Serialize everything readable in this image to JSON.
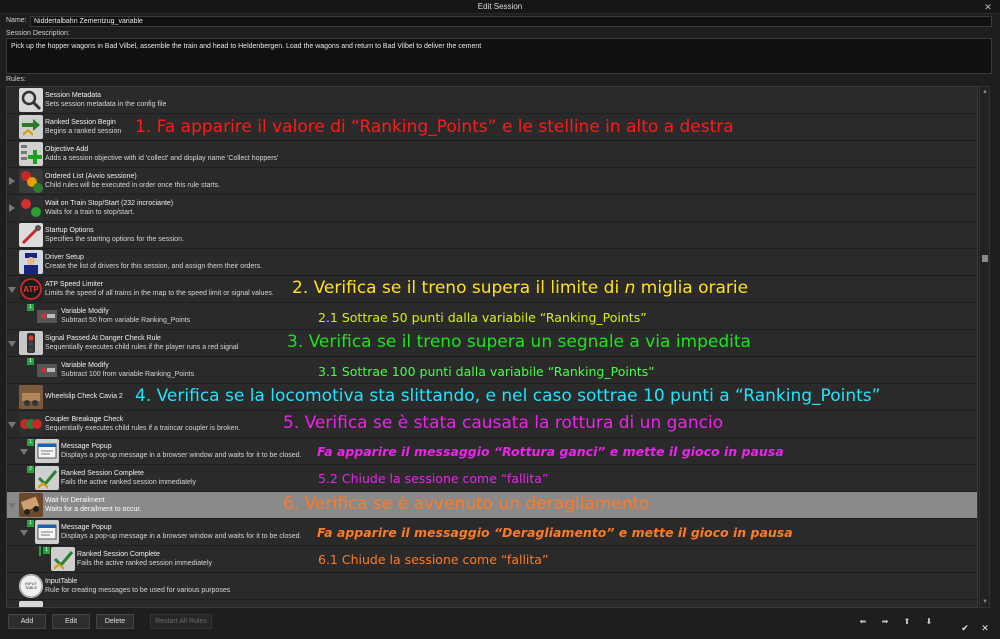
{
  "window": {
    "title": "Edit Session"
  },
  "form": {
    "name_label": "Name:",
    "name_value": "Niddertalbahn Zementzug_variable",
    "description_label": "Session Description:",
    "description_value": "Pick up the hopper wagons in Bad Vilbel, assemble the train and head to Heldenbergen. Load the wagons and return to Bad Vilbel to deliver the cement",
    "rules_label": "Rules:"
  },
  "rules": [
    {
      "name": "Session Metadata",
      "desc": "Sets session metadata in the config file",
      "icon": "magnifier-icon"
    },
    {
      "name": "Ranked Session Begin",
      "desc": "Begins a ranked session",
      "icon": "ranked-arrow-icon"
    },
    {
      "name": "Objective Add",
      "desc": "Adds a session objective with id 'collect' and display name 'Collect hoppers'",
      "icon": "objective-add-icon"
    },
    {
      "name": "Ordered List  (Avvio sessione)",
      "desc": "Child rules will be executed in order once this rule starts.",
      "icon": "ordered-list-icon"
    },
    {
      "name": "Wait on Train Stop/Start  (232 incrociante)",
      "desc": "Waits for a train to stop/start.",
      "icon": "stop-start-icon"
    },
    {
      "name": "Startup Options",
      "desc": "Specifies the starting options for the session.",
      "icon": "startup-options-icon"
    },
    {
      "name": "Driver Setup",
      "desc": "Create the list of drivers for this session, and assign them their orders.",
      "icon": "driver-icon"
    },
    {
      "name": "ATP Speed Limiter",
      "desc": "Limits the speed of all trains in the map to the speed limit or signal values.",
      "icon": "atp-icon"
    },
    {
      "name": "Variable Modify",
      "desc": "Subtract 50 from variable Ranking_Points",
      "icon": "variable-modify-icon",
      "badge": "1"
    },
    {
      "name": "Signal Passed At Danger Check Rule",
      "desc": "Sequentially executes child rules if the player runs a red signal",
      "icon": "signal-icon"
    },
    {
      "name": "Variable Modify",
      "desc": "Subtract 100 from variable Ranking_Points",
      "icon": "variable-modify-icon",
      "badge": "1"
    },
    {
      "name": "Wheelslip Check Cavia 2",
      "desc": "",
      "icon": "wheelslip-icon"
    },
    {
      "name": "Coupler Breakage Check",
      "desc": "Sequentially executes child rules if a traincar coupler is broken.",
      "icon": "coupler-icon"
    },
    {
      "name": "Message Popup",
      "desc": "Displays a pop-up message in a browser window and waits for it to be closed.",
      "icon": "message-popup-icon",
      "badge": "1"
    },
    {
      "name": "Ranked Session Complete",
      "desc": "Fails the active ranked session immediately",
      "icon": "ranked-complete-icon",
      "badge": "2"
    },
    {
      "name": "Wait for Derailment",
      "desc": "Waits for a derailment to occur.",
      "icon": "derailment-icon"
    },
    {
      "name": "Message Popup",
      "desc": "Displays a pop-up message in a browser window and waits for it to be closed.",
      "icon": "message-popup-icon",
      "badge": "1"
    },
    {
      "name": "Ranked Session Complete",
      "desc": "Fails the active ranked session immediately",
      "icon": "ranked-complete-icon",
      "badge": "1"
    },
    {
      "name": "InputTable",
      "desc": "Rule for creating messages to be used for various purposes",
      "icon": "input-table-icon",
      "icon_text": "INPUT TABLE"
    }
  ],
  "annotations": {
    "a1": "1. Fa apparire il valore di “Ranking_Points” e le stelline in alto a destra",
    "a2_pre": "2. Verifica se il treno supera il limite di ",
    "a2_n": "n",
    "a2_post": " miglia orarie",
    "a21": "2.1 Sottrae 50 punti dalla variabile “Ranking_Points”",
    "a3": "3. Verifica se il treno supera un segnale a via impedita",
    "a31": "3.1 Sottrae 100 punti dalla variabile “Ranking_Points”",
    "a4": "4. Verifica se la locomotiva sta slittando, e nel caso sottrae 10 punti a “Ranking_Points”",
    "a5": "5. Verifica se è stata causata la rottura di un gancio",
    "a51": "Fa apparire il messaggio “Rottura ganci” e mette il gioco in pausa",
    "a52": "5.2 Chiude la sessione come “fallita”",
    "a6": "6. Verifica se è avvenuto un deragliamento",
    "a6m": "Fa apparire il messaggio “Deragliamento” e mette il gioco in pausa",
    "a61": "6.1 Chiude la sessione come “fallita”"
  },
  "buttons": {
    "add": "Add",
    "edit": "Edit",
    "delete": "Delete",
    "restart_all": "Restart All Rules"
  },
  "nav_icons": [
    "arrow-left-icon",
    "arrow-right-icon",
    "arrow-up-icon",
    "arrow-down-icon"
  ],
  "corner_icons": [
    "checkmark-icon",
    "close-icon"
  ],
  "colors": {
    "selected_row": "#8a8a8a",
    "badge_green": "#22a83a",
    "annotation_red": "#ff1a1a",
    "annotation_yellow": "#ffe21a",
    "annotation_green": "#19e619",
    "annotation_cyan": "#1ee5ff",
    "annotation_magenta": "#ee22ee",
    "annotation_orange": "#ff7a22"
  }
}
